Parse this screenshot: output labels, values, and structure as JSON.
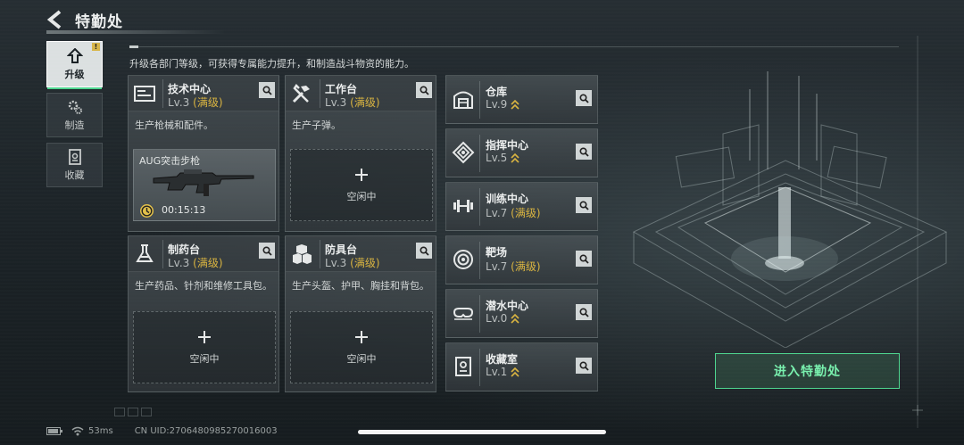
{
  "header": {
    "title": "特勤处"
  },
  "nav": {
    "items": [
      {
        "label": "升级",
        "icon": "upgrade-icon",
        "badge": "!"
      },
      {
        "label": "制造",
        "icon": "gears-icon"
      },
      {
        "label": "收藏",
        "icon": "collection-icon"
      }
    ]
  },
  "description": "升级各部门等级，可获得专属能力提升，和制造战斗物资的能力。",
  "max_label": "(满级)",
  "empty_slot_label": "空闲中",
  "departments_main": [
    {
      "name": "技术中心",
      "level": "Lv.3",
      "maxed": true,
      "desc": "生产枪械和配件。",
      "icon": "tech-center-icon",
      "slot": {
        "state": "busy",
        "item": "AUG突击步枪",
        "timer": "00:15:13"
      }
    },
    {
      "name": "工作台",
      "level": "Lv.3",
      "maxed": true,
      "desc": "生产子弹。",
      "icon": "workbench-icon",
      "slot": {
        "state": "idle"
      }
    },
    {
      "name": "制药台",
      "level": "Lv.3",
      "maxed": true,
      "desc": "生产药品、针剂和维修工具包。",
      "icon": "pharmacy-icon",
      "slot": {
        "state": "idle"
      }
    },
    {
      "name": "防具台",
      "level": "Lv.3",
      "maxed": true,
      "desc": "生产头盔、护甲、胸挂和背包。",
      "icon": "armor-bench-icon",
      "slot": {
        "state": "idle"
      }
    }
  ],
  "departments_side": [
    {
      "name": "仓库",
      "level": "Lv.9",
      "maxed": false,
      "upgradable": true,
      "icon": "warehouse-icon"
    },
    {
      "name": "指挥中心",
      "level": "Lv.5",
      "maxed": false,
      "upgradable": true,
      "icon": "command-center-icon"
    },
    {
      "name": "训练中心",
      "level": "Lv.7",
      "maxed": true,
      "upgradable": false,
      "icon": "dumbbell-icon"
    },
    {
      "name": "靶场",
      "level": "Lv.7",
      "maxed": true,
      "upgradable": false,
      "icon": "target-icon"
    },
    {
      "name": "潜水中心",
      "level": "Lv.0",
      "maxed": false,
      "upgradable": true,
      "icon": "diving-mask-icon"
    },
    {
      "name": "收藏室",
      "level": "Lv.1",
      "maxed": false,
      "upgradable": true,
      "icon": "collection-room-icon"
    }
  ],
  "enter_button": "进入特勤处",
  "status": {
    "ping": "53ms",
    "uid": "CN UID:2706480985270016003"
  },
  "colors": {
    "accent_green": "#4ed58f",
    "max_gold": "#d9b441"
  }
}
